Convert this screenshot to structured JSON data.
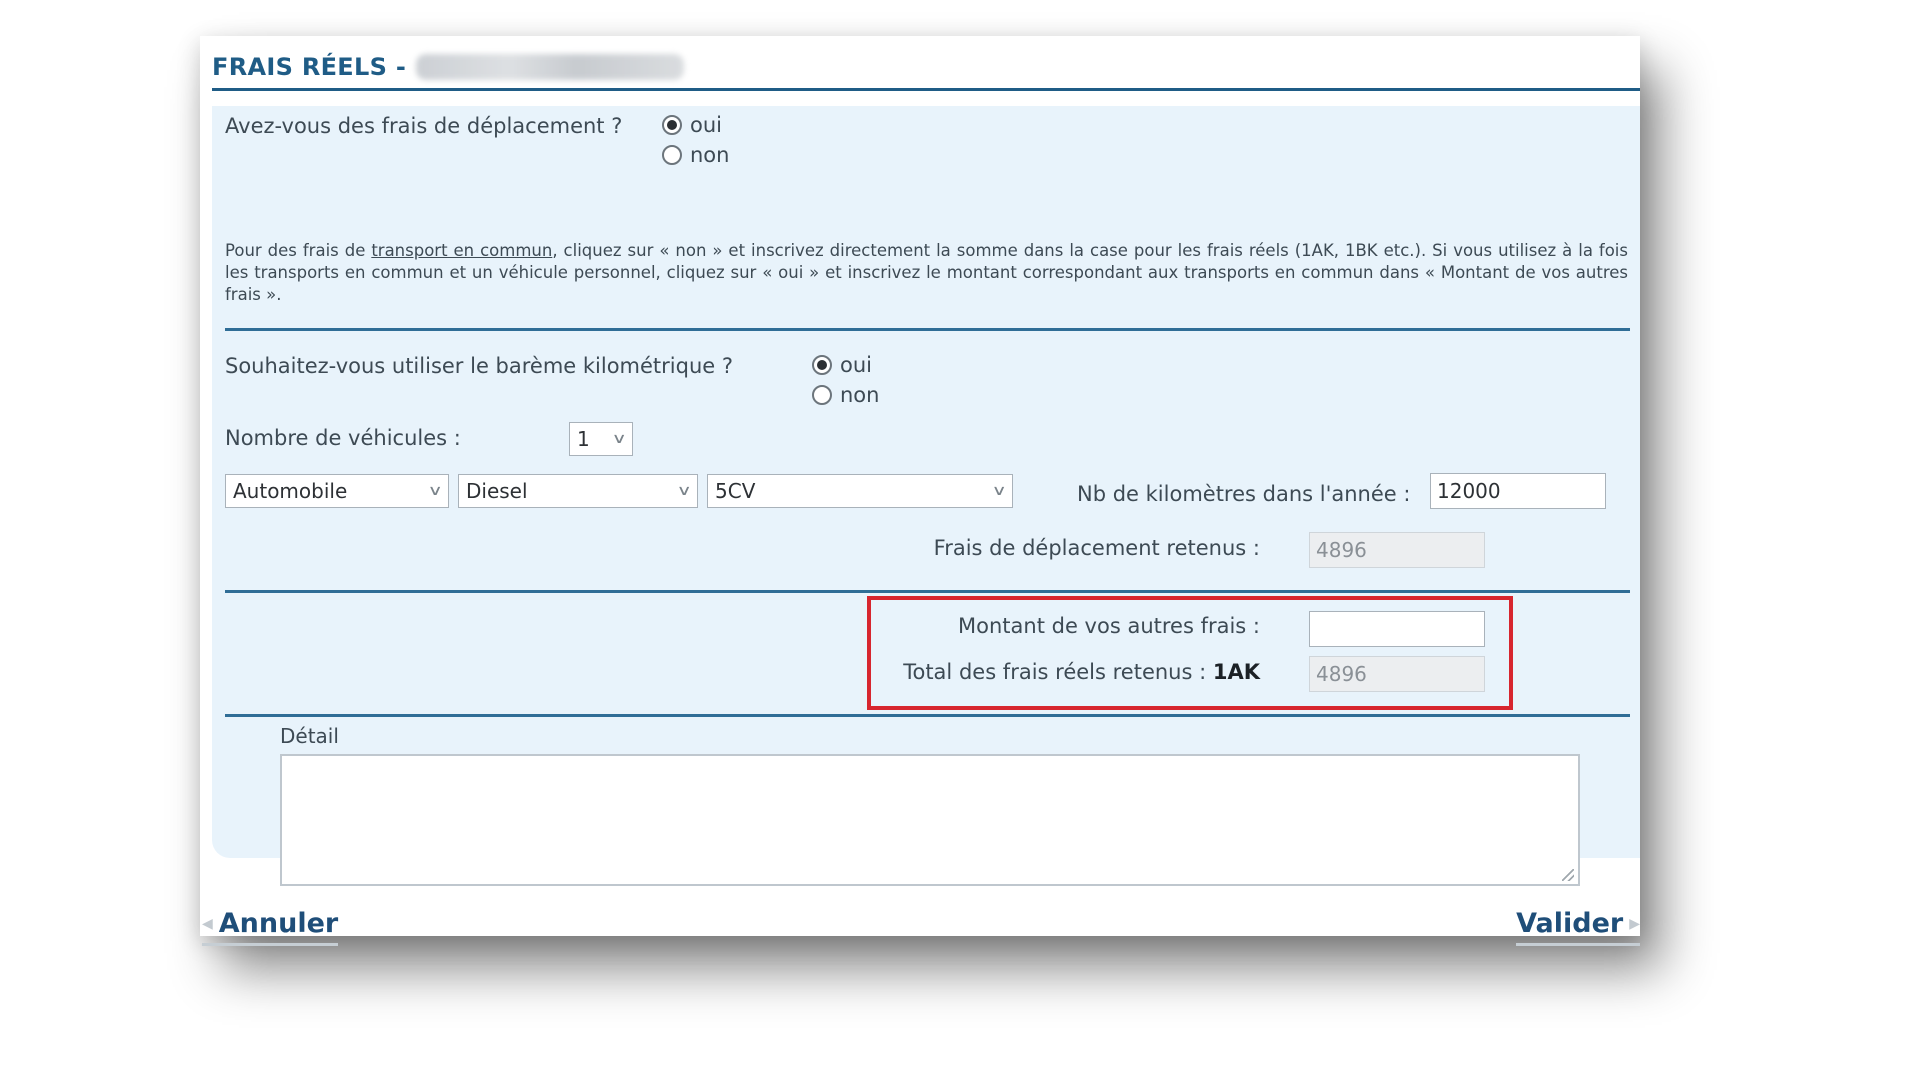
{
  "header": {
    "title": "FRAIS RÉELS -"
  },
  "deplacement": {
    "question": "Avez-vous des frais de déplacement ?",
    "options": [
      "oui",
      "non"
    ],
    "selected": "oui"
  },
  "info": {
    "prefix": "Pour des frais de ",
    "link": "transport en commun",
    "rest": ", cliquez sur « non » et inscrivez directement la somme dans la case pour les frais réels (1AK, 1BK etc.). Si vous utilisez à la fois les transports en commun et un véhicule personnel, cliquez sur « oui » et inscrivez le montant correspondant aux transports en commun dans « Montant de vos autres frais »."
  },
  "bareme": {
    "question": "Souhaitez-vous utiliser le barème kilométrique ?",
    "options": [
      "oui",
      "non"
    ],
    "selected": "oui"
  },
  "vehicules": {
    "label": "Nombre de véhicules :",
    "count": "1"
  },
  "vehicle": {
    "type": "Automobile",
    "fuel": "Diesel",
    "power": "5CV",
    "km_label": "Nb de kilomètres dans l'année :",
    "km_value": "12000"
  },
  "retenus": {
    "label": "Frais de déplacement retenus :",
    "value": "4896"
  },
  "autres": {
    "label": "Montant de vos autres frais :",
    "value": ""
  },
  "total": {
    "label": "Total des frais réels retenus :",
    "code": "1AK",
    "value": "4896"
  },
  "detail": {
    "label": "Détail",
    "value": ""
  },
  "footer": {
    "cancel": "Annuler",
    "validate": "Valider"
  },
  "colors": {
    "title": "#1f5c86",
    "panel": "#e8f3fb",
    "highlight": "#d7252e"
  }
}
